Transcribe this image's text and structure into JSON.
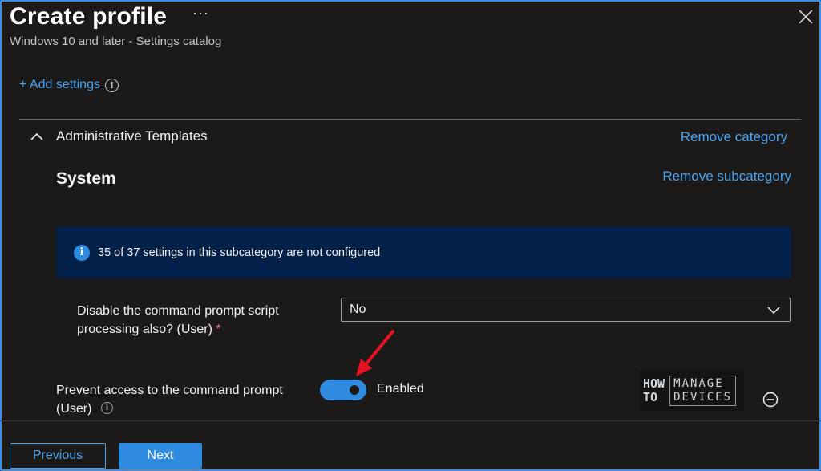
{
  "header": {
    "title": "Create profile",
    "more_glyph": "···",
    "subtitle": "Windows 10 and later - Settings catalog",
    "close_icon": "close-icon"
  },
  "add_settings": {
    "label": "+ Add settings",
    "info_icon": "info-icon"
  },
  "category": {
    "name": "Administrative Templates",
    "remove_label": "Remove category",
    "expanded": true
  },
  "subcategory": {
    "name": "System",
    "remove_label": "Remove subcategory"
  },
  "info_banner": {
    "text": "35 of 37 settings in this subcategory are not configured"
  },
  "settings": [
    {
      "label": "Disable the command prompt script processing also? (User)",
      "required_mark": "*",
      "value": "No"
    },
    {
      "label": "Prevent access to the command prompt (User)",
      "toggle_state": "Enabled",
      "toggle_on": true
    }
  ],
  "watermark": {
    "line1": "HOW",
    "line2": "TO",
    "box1": "MANAGE",
    "box2": "DEVICES"
  },
  "footer": {
    "previous_label": "Previous",
    "next_label": "Next"
  },
  "colors": {
    "accent": "#2f8be0",
    "link": "#4aa3f0",
    "banner_bg": "#04214a",
    "background": "#1b1a19",
    "arrow": "#e81123"
  }
}
